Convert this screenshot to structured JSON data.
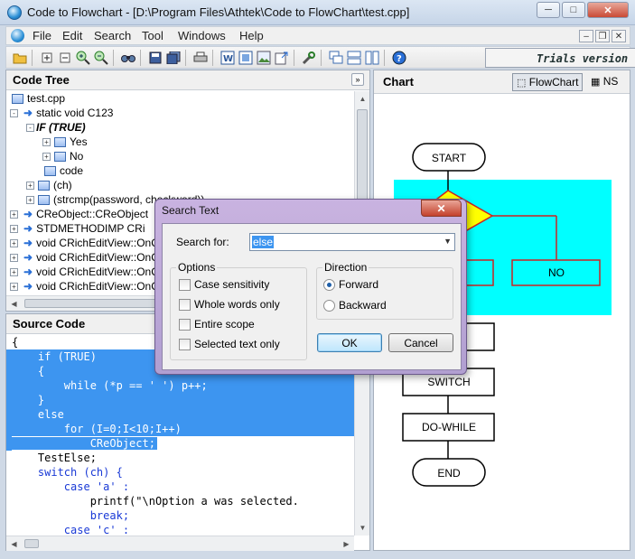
{
  "window": {
    "title": "Code to Flowchart - [D:\\Program Files\\Athtek\\Code to FlowChart\\test.cpp]",
    "minimize": "─",
    "maximize": "□",
    "close": "✕"
  },
  "menu": {
    "items": [
      "File",
      "Edit",
      "Search",
      "Tool",
      "Windows",
      "Help"
    ],
    "mdi_minimize": "–",
    "mdi_restore": "❐",
    "mdi_close": "✕"
  },
  "toolbar": {
    "trial_text": "Trials version"
  },
  "code_tree": {
    "title": "Code Tree",
    "collapse": "»",
    "rows": [
      {
        "plus": "",
        "arrow": "",
        "icon": true,
        "text": "test.cpp"
      },
      {
        "plus": "-",
        "arrow": "➜",
        "icon": false,
        "text": "static void C123"
      },
      {
        "plus": "-",
        "arrow": "",
        "icon": false,
        "text": "IF  (TRUE)"
      },
      {
        "plus": "+",
        "arrow": "",
        "icon": true,
        "text": "Yes"
      },
      {
        "plus": "+",
        "arrow": "",
        "icon": true,
        "text": "No"
      },
      {
        "plus": "",
        "arrow": "",
        "icon": true,
        "text": "code"
      },
      {
        "plus": "+",
        "arrow": "",
        "icon": true,
        "text": "(ch)"
      },
      {
        "plus": "+",
        "arrow": "",
        "icon": true,
        "text": "(strcmp(password, checkword))"
      },
      {
        "plus": "+",
        "arrow": "➜",
        "icon": false,
        "text": "CReObject::CReObject"
      },
      {
        "plus": "+",
        "arrow": "➜",
        "icon": false,
        "text": "STDMETHODIMP CRi"
      },
      {
        "plus": "+",
        "arrow": "➜",
        "icon": false,
        "text": "void CRichEditView::OnC"
      },
      {
        "plus": "+",
        "arrow": "➜",
        "icon": false,
        "text": "void CRichEditView::OnC"
      },
      {
        "plus": "+",
        "arrow": "➜",
        "icon": false,
        "text": "void CRichEditView::OnC"
      },
      {
        "plus": "+",
        "arrow": "➜",
        "icon": false,
        "text": "void CRichEditView::OnC"
      }
    ]
  },
  "source_code": {
    "title": "Source Code",
    "lines": [
      {
        "text": "{",
        "hl": false,
        "kw": false
      },
      {
        "text": "    if (TRUE)",
        "hl": true,
        "kw": true
      },
      {
        "text": "    {",
        "hl": true,
        "kw": true
      },
      {
        "text": "        while (*p == ' ') p++;",
        "hl": true,
        "kw": true
      },
      {
        "text": "    }",
        "hl": true,
        "kw": true
      },
      {
        "text": "    else",
        "hl": true,
        "kw": true
      },
      {
        "text": "        for (I=0;I<10;I++)",
        "hl": true,
        "kw": true
      },
      {
        "text": "            CReObject;",
        "hl": true,
        "kw": false
      },
      {
        "text": "    TestElse;",
        "hl": false,
        "kw": false
      },
      {
        "text": "    switch (ch) {",
        "hl": false,
        "kw": true
      },
      {
        "text": "        case 'a' :",
        "hl": false,
        "kw": true
      },
      {
        "text": "            printf(\"\\nOption a was selected.",
        "hl": false,
        "kw": false
      },
      {
        "text": "            break;",
        "hl": false,
        "kw": true
      },
      {
        "text": "        case 'c' :",
        "hl": false,
        "kw": true
      }
    ]
  },
  "chart": {
    "title": "Chart",
    "tab_flowchart": "FlowChart",
    "tab_ns": "NS",
    "nodes": {
      "start": "START",
      "no": "NO",
      "switch": "SWITCH",
      "do_while": "DO-WHILE",
      "end": "END"
    },
    "highlight_color": "#00ffff",
    "stroke_color": "#cc2222"
  },
  "dialog": {
    "title": "Search Text",
    "close": "✕",
    "search_label": "Search for:",
    "search_value": "else",
    "options_title": "Options",
    "options": [
      "Case sensitivity",
      "Whole words only",
      "Entire scope",
      "Selected text only"
    ],
    "direction_title": "Direction",
    "forward": "Forward",
    "backward": "Backward",
    "ok": "OK",
    "cancel": "Cancel"
  }
}
